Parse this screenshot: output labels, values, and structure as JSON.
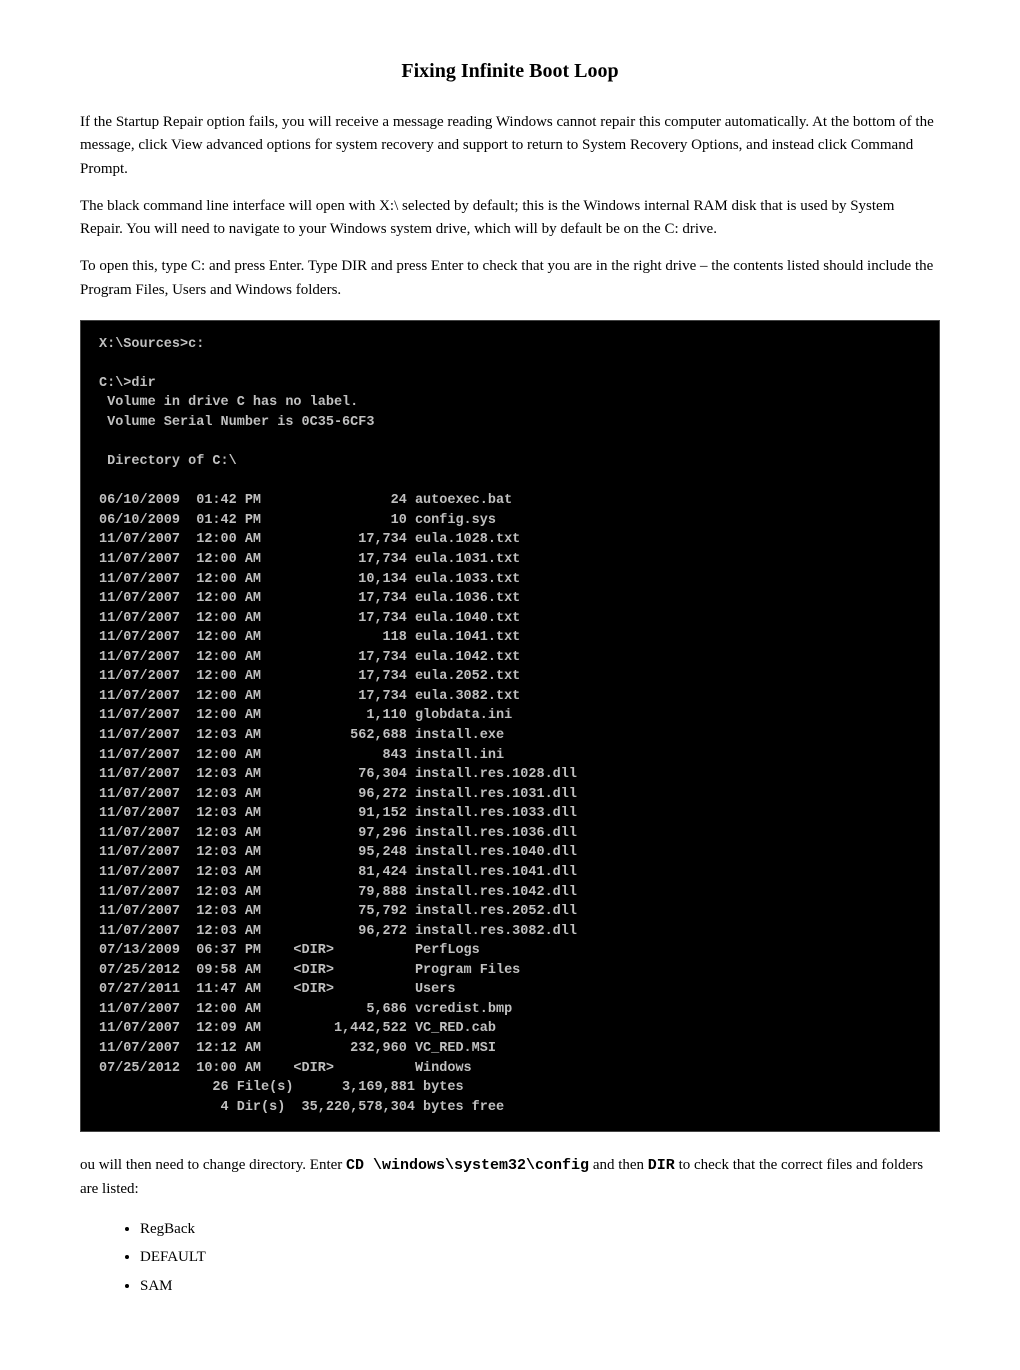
{
  "page": {
    "title": "Fixing Infinite Boot Loop",
    "para1": "If the Startup Repair option fails, you will receive a message reading Windows cannot repair this computer automatically. At the bottom of the message, click View advanced options for system recovery and support to return to System Recovery Options, and instead click Command Prompt.",
    "para2": "The black command line interface will open with X:\\ selected by default; this is the Windows internal RAM disk that is used by System Repair. You will need to navigate to your Windows system drive, which will by default be on the C: drive.",
    "para3": "To open this, type C: and press Enter. Type DIR and press Enter to check that you are in the right drive – the contents listed should include the Program Files, Users and Windows folders.",
    "terminal_content": "X:\\Sources>c:\n\nC:\\>dir\n Volume in drive C has no label.\n Volume Serial Number is 0C35-6CF3\n\n Directory of C:\\\n\n06/10/2009  01:42 PM                24 autoexec.bat\n06/10/2009  01:42 PM                10 config.sys\n11/07/2007  12:00 AM            17,734 eula.1028.txt\n11/07/2007  12:00 AM            17,734 eula.1031.txt\n11/07/2007  12:00 AM            10,134 eula.1033.txt\n11/07/2007  12:00 AM            17,734 eula.1036.txt\n11/07/2007  12:00 AM            17,734 eula.1040.txt\n11/07/2007  12:00 AM               118 eula.1041.txt\n11/07/2007  12:00 AM            17,734 eula.1042.txt\n11/07/2007  12:00 AM            17,734 eula.2052.txt\n11/07/2007  12:00 AM            17,734 eula.3082.txt\n11/07/2007  12:00 AM             1,110 globdata.ini\n11/07/2007  12:03 AM           562,688 install.exe\n11/07/2007  12:00 AM               843 install.ini\n11/07/2007  12:03 AM            76,304 install.res.1028.dll\n11/07/2007  12:03 AM            96,272 install.res.1031.dll\n11/07/2007  12:03 AM            91,152 install.res.1033.dll\n11/07/2007  12:03 AM            97,296 install.res.1036.dll\n11/07/2007  12:03 AM            95,248 install.res.1040.dll\n11/07/2007  12:03 AM            81,424 install.res.1041.dll\n11/07/2007  12:03 AM            79,888 install.res.1042.dll\n11/07/2007  12:03 AM            75,792 install.res.2052.dll\n11/07/2007  12:03 AM            96,272 install.res.3082.dll\n07/13/2009  06:37 PM    <DIR>          PerfLogs\n07/25/2012  09:58 AM    <DIR>          Program Files\n07/27/2011  11:47 AM    <DIR>          Users\n11/07/2007  12:00 AM             5,686 vcredist.bmp\n11/07/2007  12:09 AM         1,442,522 VC_RED.cab\n11/07/2007  12:12 AM           232,960 VC_RED.MSI\n07/25/2012  10:00 AM    <DIR>          Windows\n              26 File(s)      3,169,881 bytes\n               4 Dir(s)  35,220,578,304 bytes free",
    "para4_prefix": "ou will then need to change directory. Enter ",
    "para4_code": "CD \\windows\\system32\\config",
    "para4_middle": " and then ",
    "para4_code2": "DIR",
    "para4_suffix": " to check that the correct files and folders are listed:",
    "bullets": [
      "RegBack",
      "DEFAULT",
      "SAM"
    ]
  }
}
